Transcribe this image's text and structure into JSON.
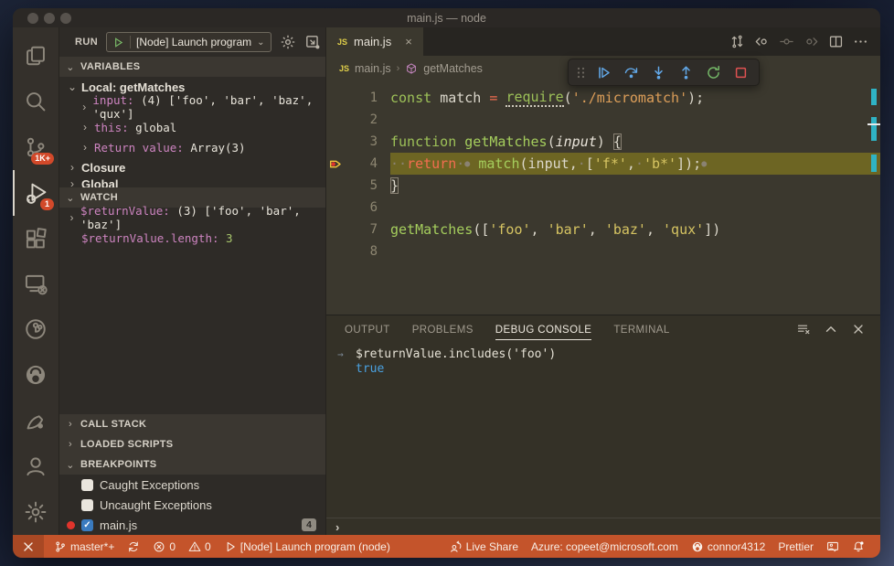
{
  "window": {
    "title": "main.js — node",
    "traffic_lights": [
      "close",
      "minimize",
      "zoom"
    ]
  },
  "colors": {
    "status_bar": "#c4542b",
    "badge": "#d2492a",
    "current_line_highlight": "#6d6523",
    "overview_mark": "#2fb3c4",
    "console_result_blue": "#4aa1e0",
    "variable_name_pink": "#cd84c0",
    "keyword_green": "#9dc158",
    "return_red": "#f26d50",
    "string_yellow": "#d6c462",
    "module_string_orange": "#dfa05a",
    "breakpoint_red": "#e0342c",
    "debug_arrow_yellow": "#f0c33c"
  },
  "activity_bar": {
    "items": [
      {
        "name": "explorer",
        "icon": "files-icon"
      },
      {
        "name": "search",
        "icon": "search-icon"
      },
      {
        "name": "source-control",
        "icon": "source-control-icon",
        "badge": "1K+"
      },
      {
        "name": "run-and-debug",
        "icon": "debug-icon",
        "badge": "1",
        "active": true
      },
      {
        "name": "extensions",
        "icon": "extensions-icon"
      },
      {
        "name": "remote-explorer",
        "icon": "remote-icon"
      },
      {
        "name": "run-circle",
        "icon": "run-circle-icon"
      },
      {
        "name": "github",
        "icon": "github-icon"
      },
      {
        "name": "gitlens",
        "icon": "feather-icon"
      }
    ],
    "bottom_items": [
      {
        "name": "accounts",
        "icon": "account-icon"
      },
      {
        "name": "settings",
        "icon": "settings-icon"
      }
    ]
  },
  "sidebar": {
    "run_label": "RUN",
    "run_config": "[Node] Launch program",
    "variables": {
      "title": "VARIABLES",
      "rows": [
        {
          "indent": 1,
          "chev": "v",
          "tokens": [
            {
              "t": "Local: getMatches",
              "s": "bold"
            }
          ]
        },
        {
          "indent": 2,
          "chev": ">",
          "tokens": [
            {
              "t": "input:",
              "s": "name"
            },
            {
              "t": " (4) ['foo', 'bar', 'baz', 'qux']",
              "s": "val"
            }
          ]
        },
        {
          "indent": 2,
          "chev": ">",
          "tokens": [
            {
              "t": "this:",
              "s": "name"
            },
            {
              "t": " global",
              "s": "val"
            }
          ]
        },
        {
          "indent": 2,
          "chev": ">",
          "tokens": [
            {
              "t": "Return value:",
              "s": "name"
            },
            {
              "t": " Array(3)",
              "s": "val"
            }
          ]
        },
        {
          "indent": 1,
          "chev": ">",
          "tokens": [
            {
              "t": "Closure",
              "s": "bold"
            }
          ]
        },
        {
          "indent": 1,
          "chev": ">",
          "clipped": true,
          "tokens": [
            {
              "t": "Global",
              "s": "bold"
            }
          ]
        }
      ]
    },
    "watch": {
      "title": "WATCH",
      "rows": [
        {
          "indent": 1,
          "chev": ">",
          "tokens": [
            {
              "t": "$returnValue:",
              "s": "name"
            },
            {
              "t": " (3) ['foo', 'bar', 'baz']",
              "s": "val"
            }
          ]
        },
        {
          "indent": 1,
          "chev": "",
          "tokens": [
            {
              "t": "$returnValue.length:",
              "s": "name"
            },
            {
              "t": " 3",
              "s": "num"
            }
          ]
        }
      ]
    },
    "collapsed_sections": [
      {
        "title": "CALL STACK"
      },
      {
        "title": "LOADED SCRIPTS"
      }
    ],
    "breakpoints": {
      "title": "BREAKPOINTS",
      "rows": [
        {
          "label": "Caught Exceptions",
          "checked": false
        },
        {
          "label": "Uncaught Exceptions",
          "checked": false
        },
        {
          "label": "main.js",
          "checked": true,
          "dot": true,
          "badge": "4"
        }
      ]
    }
  },
  "editor": {
    "tab": {
      "label": "main.js",
      "icon": "js-icon",
      "close": "×"
    },
    "actions": [
      {
        "name": "open-changes",
        "icon": "compare-icon"
      },
      {
        "name": "navigate-back",
        "icon": "nav-back-icon"
      },
      {
        "name": "navigate-position",
        "icon": "nav-circle-icon",
        "dim": true
      },
      {
        "name": "navigate-forward",
        "icon": "nav-forward-icon",
        "dim": true
      },
      {
        "name": "split-editor",
        "icon": "split-icon"
      },
      {
        "name": "more-actions",
        "icon": "more-icon"
      }
    ],
    "breadcrumb": {
      "file": "main.js",
      "symbol": "getMatches"
    },
    "debug_toolbar": [
      {
        "name": "drag-handle",
        "icon": "grip-icon",
        "color": "#6e6961"
      },
      {
        "name": "continue",
        "icon": "continue-icon",
        "color": "#62a8e8"
      },
      {
        "name": "step-over",
        "icon": "stepover-icon",
        "color": "#62a8e8"
      },
      {
        "name": "step-into",
        "icon": "stepinto-icon",
        "color": "#62a8e8"
      },
      {
        "name": "step-out",
        "icon": "stepout-icon",
        "color": "#62a8e8"
      },
      {
        "name": "restart",
        "icon": "restart-icon",
        "color": "#74b767"
      },
      {
        "name": "stop",
        "icon": "stop-icon",
        "color": "#e05252"
      }
    ],
    "current_line": 4,
    "lines": [
      {
        "num": 1,
        "tokens": [
          {
            "t": "const",
            "s": "kw"
          },
          {
            "t": " "
          },
          {
            "t": "match"
          },
          {
            "t": " "
          },
          {
            "t": "=",
            "s": "ret"
          },
          {
            "t": " "
          },
          {
            "t": "require",
            "s": "fnu"
          },
          {
            "t": "(",
            "s": "pun"
          },
          {
            "t": "'./micromatch'",
            "s": "path"
          },
          {
            "t": ");",
            "s": "pun"
          }
        ]
      },
      {
        "num": 2,
        "tokens": []
      },
      {
        "num": 3,
        "tokens": [
          {
            "t": "function",
            "s": "kw"
          },
          {
            "t": " "
          },
          {
            "t": "getMatches",
            "s": "fn"
          },
          {
            "t": "(",
            "s": "pun"
          },
          {
            "t": "input",
            "s": "param"
          },
          {
            "t": ")",
            "s": "pun"
          },
          {
            "t": " "
          },
          {
            "t": "{",
            "s": "brk"
          }
        ]
      },
      {
        "num": 4,
        "tokens": [
          {
            "t": "··",
            "s": "ws"
          },
          {
            "t": "return",
            "s": "ret"
          },
          {
            "t": "·",
            "s": "ws"
          },
          {
            "t": "●",
            "s": "dot"
          },
          {
            "t": " "
          },
          {
            "t": "match",
            "s": "fn"
          },
          {
            "t": "(",
            "s": "pun"
          },
          {
            "t": "input"
          },
          {
            "t": ",",
            "s": "pun"
          },
          {
            "t": "·",
            "s": "ws"
          },
          {
            "t": "[",
            "s": "pun"
          },
          {
            "t": "'f*'",
            "s": "str"
          },
          {
            "t": ",",
            "s": "pun"
          },
          {
            "t": "·",
            "s": "ws"
          },
          {
            "t": "'b*'",
            "s": "str"
          },
          {
            "t": "]);",
            "s": "pun"
          },
          {
            "t": "●",
            "s": "dot"
          }
        ]
      },
      {
        "num": 5,
        "tokens": [
          {
            "t": "}",
            "s": "brk"
          }
        ]
      },
      {
        "num": 6,
        "tokens": []
      },
      {
        "num": 7,
        "tokens": [
          {
            "t": "getMatches",
            "s": "fn"
          },
          {
            "t": "(",
            "s": "pun"
          },
          {
            "t": "[",
            "s": "pun"
          },
          {
            "t": "'foo'",
            "s": "str"
          },
          {
            "t": ", ",
            "s": "pun"
          },
          {
            "t": "'bar'",
            "s": "str"
          },
          {
            "t": ", ",
            "s": "pun"
          },
          {
            "t": "'baz'",
            "s": "str"
          },
          {
            "t": ", ",
            "s": "pun"
          },
          {
            "t": "'qux'",
            "s": "str"
          },
          {
            "t": "])",
            "s": "pun"
          }
        ]
      },
      {
        "num": 8,
        "tokens": []
      }
    ]
  },
  "panel": {
    "tabs": [
      "OUTPUT",
      "PROBLEMS",
      "DEBUG CONSOLE",
      "TERMINAL"
    ],
    "active_tab": "DEBUG CONSOLE",
    "tools": [
      {
        "name": "clear-console",
        "icon": "clear-icon"
      },
      {
        "name": "maximize-panel",
        "icon": "collapse-icon"
      },
      {
        "name": "close-panel",
        "icon": "close-icon"
      }
    ],
    "console": {
      "expression": "$returnValue.includes('foo')",
      "result": "true",
      "prompt": "›"
    }
  },
  "status_bar": {
    "left": [
      {
        "name": "remote-indicator",
        "icon": "remote-x-icon",
        "label": ""
      },
      {
        "name": "git-branch",
        "icon": "branch-icon",
        "label": "master*+"
      },
      {
        "name": "sync",
        "icon": "sync-icon",
        "label": ""
      },
      {
        "name": "errors",
        "icon": "error-icon",
        "label": "0"
      },
      {
        "name": "warnings",
        "icon": "warn-icon",
        "label": "0"
      },
      {
        "name": "debug-session",
        "icon": "play-icon",
        "label": "[Node] Launch program (node)"
      }
    ],
    "right": [
      {
        "name": "live-share",
        "icon": "liveshare-icon",
        "label": "Live Share"
      },
      {
        "name": "azure-account",
        "icon": "",
        "label": "Azure: copeet@microsoft.com"
      },
      {
        "name": "github-account",
        "icon": "github-small-icon",
        "label": "connor4312"
      },
      {
        "name": "prettier",
        "icon": "",
        "label": "Prettier"
      },
      {
        "name": "feedback",
        "icon": "feedback-icon",
        "label": ""
      },
      {
        "name": "notifications",
        "icon": "bell-icon",
        "label": "",
        "dot": true
      }
    ]
  }
}
